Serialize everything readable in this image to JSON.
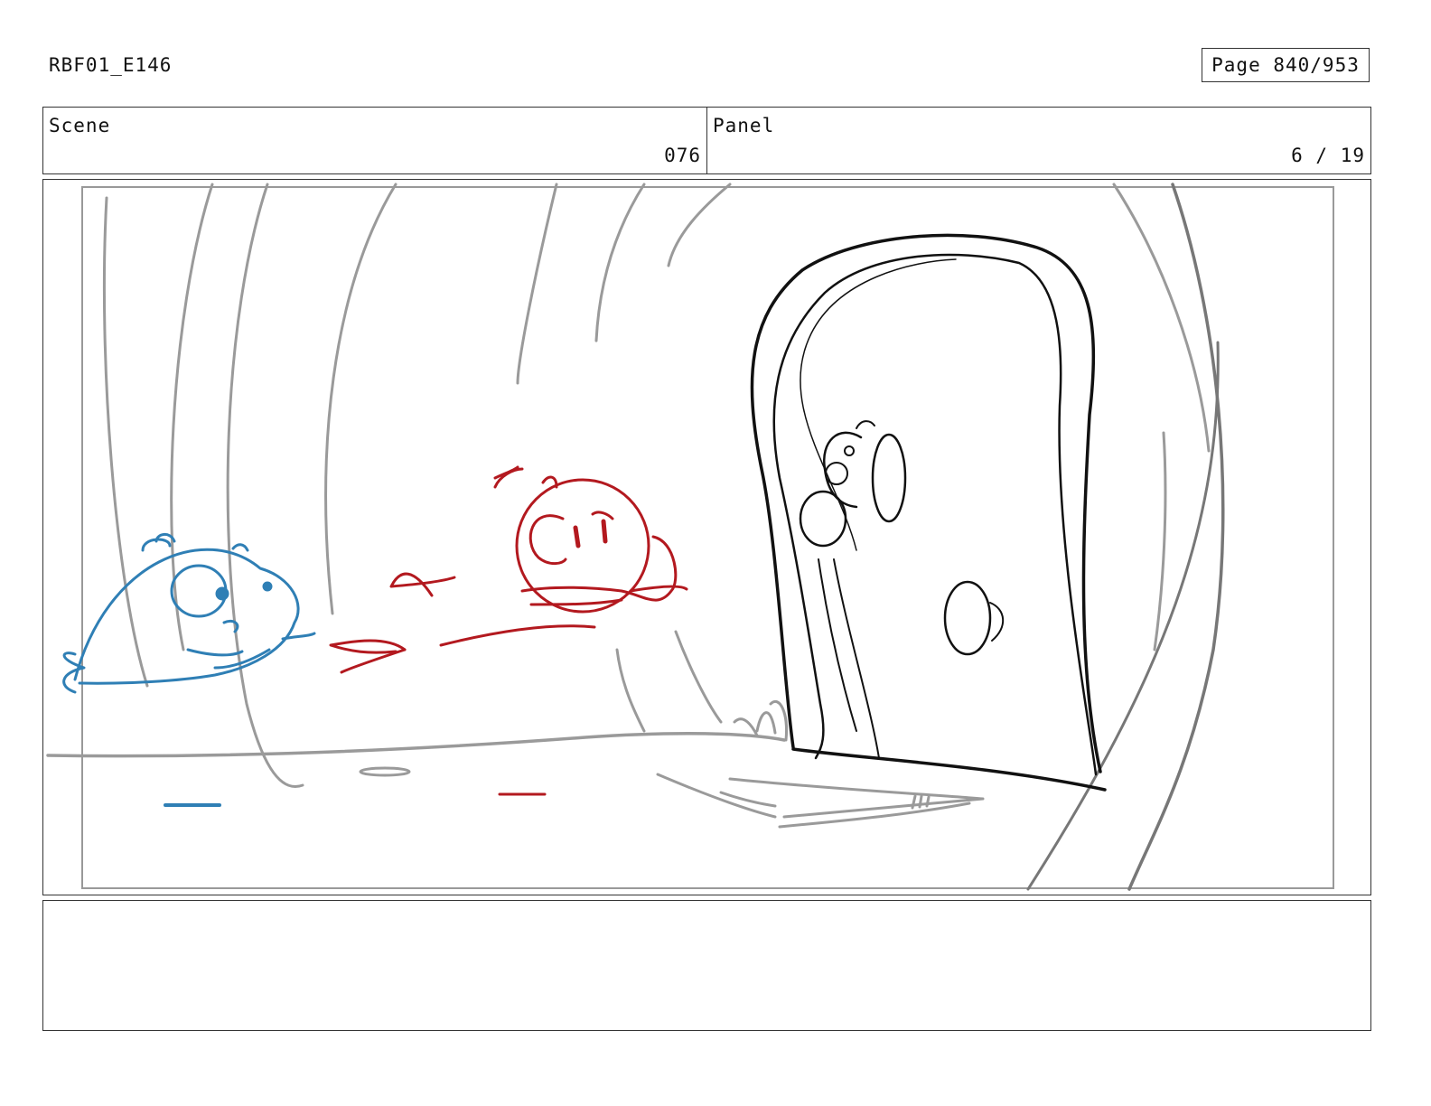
{
  "header": {
    "doc_id": "RBF01_E146",
    "page_label": "Page 840/953"
  },
  "scene": {
    "label": "Scene",
    "value": "076"
  },
  "panel": {
    "label": "Panel",
    "value": "6 / 19"
  },
  "drawing": {
    "colors": {
      "background_lines": "#9a9a9a",
      "door_ink": "#111111",
      "blue_fish": "#2f7fb5",
      "red_fish": "#b3191f"
    }
  },
  "notes": {
    "text": ""
  }
}
